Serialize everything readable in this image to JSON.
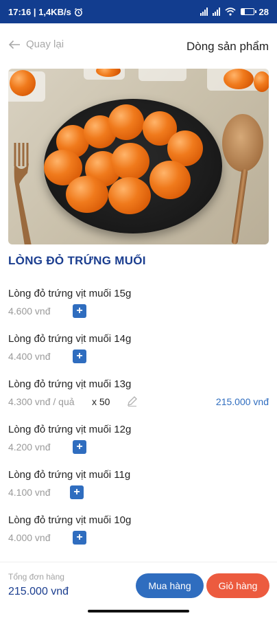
{
  "status_bar": {
    "time_speed": "17:16 | 1,4KB/s",
    "alarm_icon": "alarm-clock-icon",
    "battery_level": "28"
  },
  "header": {
    "back_label": "Quay lại",
    "title": "Dòng sản phẩm"
  },
  "product": {
    "image_icon": "salted-egg-yolk-photo",
    "name": "LÒNG ĐỎ TRỨNG MUỐI"
  },
  "variants": [
    {
      "name": "Lòng đỏ trứng vịt muối 15g",
      "price": "4.600 vnđ"
    },
    {
      "name": "Lòng đỏ trứng vịt muối 14g",
      "price": "4.400 vnđ"
    },
    {
      "name": "Lòng đỏ trứng vịt muối 13g",
      "price": "4.300 vnđ / quả",
      "quantity": "x 50",
      "total": "215.000 vnđ"
    },
    {
      "name": "Lòng đỏ trứng vịt muối 12g",
      "price": "4.200 vnđ"
    },
    {
      "name": "Lòng đỏ trứng vịt muối 11g",
      "price": "4.100 vnđ"
    },
    {
      "name": "Lòng đỏ trứng vịt muối 10g",
      "price": "4.000 vnđ"
    }
  ],
  "add_symbol": "+",
  "footer": {
    "total_label": "Tổng đơn hàng",
    "total_value": "215.000 vnđ",
    "buy_label": "Mua hàng",
    "cart_label": "Giỏ hàng"
  },
  "colors": {
    "status_bar": "#123d8f",
    "brand_blue": "#2f6dbf",
    "title_blue": "#1a3d8f",
    "cart_red": "#ec5b3f"
  }
}
